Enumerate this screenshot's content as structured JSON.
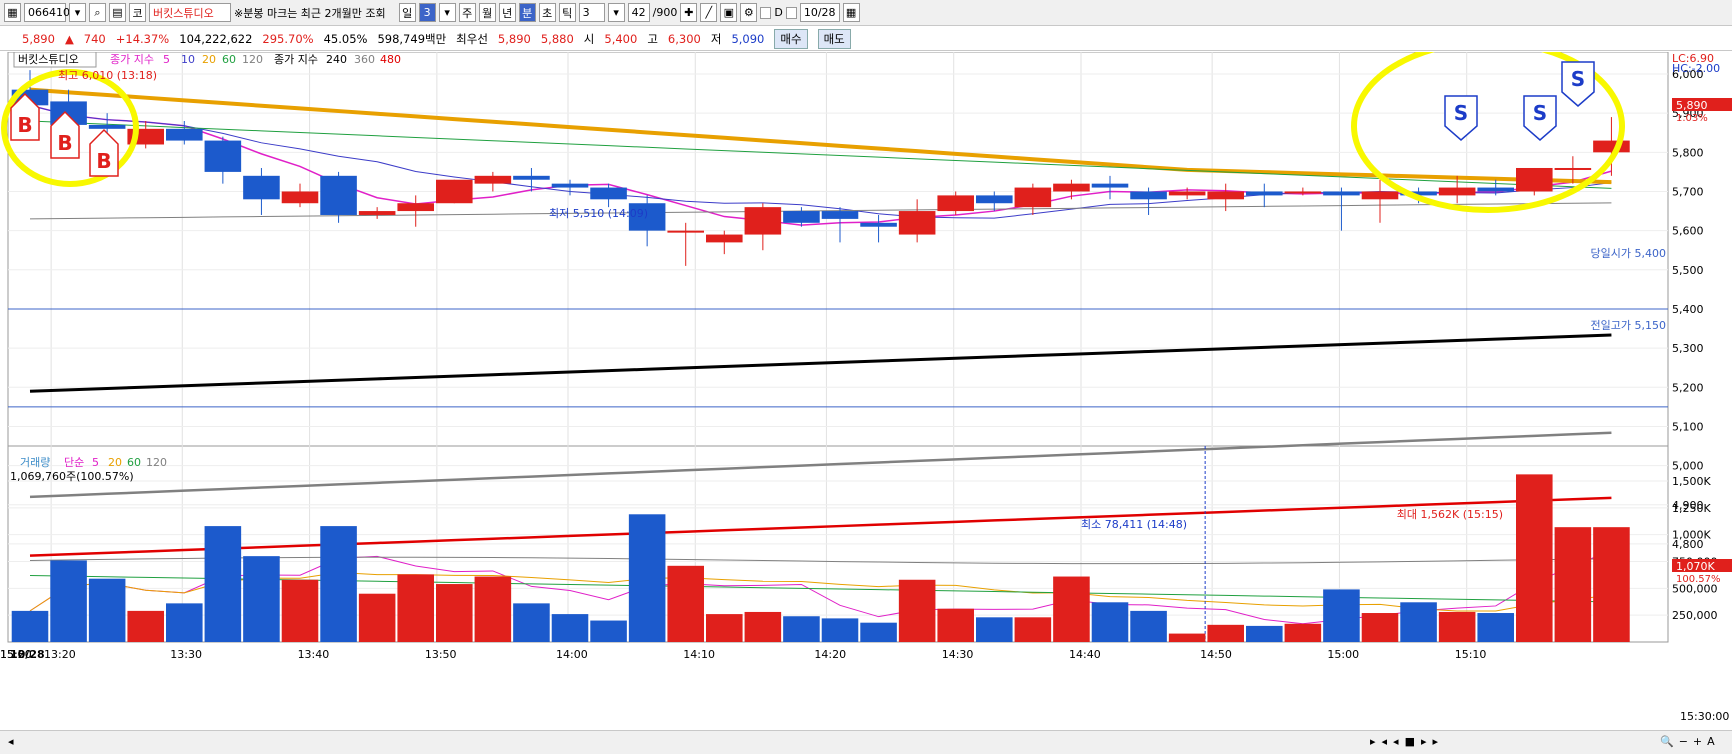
{
  "toolbar": {
    "code": "066410",
    "exchange_icon": "코",
    "stock_name": "버킷스튜디오",
    "notice": "※분봉 마크는 최근 2개월만 조회",
    "period_buttons": [
      "일",
      "3"
    ],
    "period_tabs": [
      "주",
      "월",
      "년",
      "분",
      "초",
      "틱"
    ],
    "interval": "3",
    "count": "42",
    "count_total": "/900",
    "d_label": "D",
    "date": "10/28"
  },
  "info": {
    "price": "5,890",
    "change": "740",
    "change_pct": "+14.37%",
    "volume": "104,222,622",
    "vol_ratio": "295.70%",
    "turnover": "45.05%",
    "amount": "598,749백만",
    "best_ask_label": "최우선",
    "best_ask": "5,890",
    "best_bid": "5,880",
    "open_label": "시",
    "open": "5,400",
    "high_label": "고",
    "high": "6,300",
    "low_label": "저",
    "low": "5,090",
    "buy_label": "매수",
    "sell_label": "매도"
  },
  "colors": {
    "up": "#e0201c",
    "down": "#1c5acc",
    "ma5": "#e020c8",
    "ma10": "#3c3cc8",
    "ma20": "#e8a000",
    "ma60": "#20a040",
    "ma120": "#808080",
    "ma240": "#000000",
    "ma360": "#808080",
    "ma480": "#e00000",
    "marker_yellow": "#f8f800"
  },
  "chart_data": [
    {
      "type": "candlestick",
      "legend": {
        "name": "버킷스튜디오",
        "close_ma_label": "종가 지수",
        "periods": [
          "5",
          "10",
          "20",
          "60",
          "120"
        ],
        "close_ma_label2": "종가 지수",
        "periods2": [
          "240",
          "360",
          "480"
        ]
      },
      "x": [
        "13:18",
        "13:21",
        "13:24",
        "13:27",
        "13:30",
        "13:33",
        "13:36",
        "13:39",
        "13:42",
        "13:45",
        "13:48",
        "13:51",
        "13:54",
        "13:57",
        "14:00",
        "14:03",
        "14:06",
        "14:09",
        "14:12",
        "14:15",
        "14:18",
        "14:21",
        "14:24",
        "14:27",
        "14:30",
        "14:33",
        "14:36",
        "14:39",
        "14:42",
        "14:45",
        "14:48",
        "14:51",
        "14:54",
        "14:57",
        "15:00",
        "15:03",
        "15:06",
        "15:09",
        "15:12",
        "15:15",
        "15:18",
        "15:30"
      ],
      "ohlc": [
        [
          5960,
          6010,
          5900,
          5920
        ],
        [
          5930,
          5960,
          5860,
          5870
        ],
        [
          5870,
          5900,
          5820,
          5860
        ],
        [
          5820,
          5880,
          5810,
          5860
        ],
        [
          5860,
          5880,
          5820,
          5830
        ],
        [
          5830,
          5840,
          5720,
          5750
        ],
        [
          5740,
          5760,
          5640,
          5680
        ],
        [
          5670,
          5720,
          5660,
          5700
        ],
        [
          5740,
          5750,
          5620,
          5640
        ],
        [
          5640,
          5660,
          5630,
          5650
        ],
        [
          5650,
          5690,
          5610,
          5670
        ],
        [
          5670,
          5730,
          5670,
          5730
        ],
        [
          5720,
          5750,
          5700,
          5740
        ],
        [
          5740,
          5760,
          5700,
          5730
        ],
        [
          5720,
          5730,
          5690,
          5710
        ],
        [
          5710,
          5720,
          5660,
          5680
        ],
        [
          5670,
          5690,
          5560,
          5600
        ],
        [
          5600,
          5620,
          5510,
          5600
        ],
        [
          5570,
          5600,
          5540,
          5590
        ],
        [
          5590,
          5670,
          5550,
          5660
        ],
        [
          5650,
          5660,
          5610,
          5620
        ],
        [
          5650,
          5660,
          5570,
          5630
        ],
        [
          5620,
          5640,
          5570,
          5610
        ],
        [
          5590,
          5680,
          5570,
          5650
        ],
        [
          5650,
          5700,
          5640,
          5690
        ],
        [
          5690,
          5700,
          5650,
          5670
        ],
        [
          5660,
          5720,
          5640,
          5710
        ],
        [
          5700,
          5730,
          5680,
          5720
        ],
        [
          5720,
          5740,
          5680,
          5710
        ],
        [
          5700,
          5710,
          5640,
          5680
        ],
        [
          5690,
          5710,
          5680,
          5700
        ],
        [
          5680,
          5720,
          5650,
          5700
        ],
        [
          5700,
          5720,
          5660,
          5690
        ],
        [
          5700,
          5710,
          5690,
          5700
        ],
        [
          5700,
          5710,
          5600,
          5690
        ],
        [
          5680,
          5730,
          5620,
          5700
        ],
        [
          5700,
          5710,
          5670,
          5690
        ],
        [
          5690,
          5740,
          5670,
          5710
        ],
        [
          5710,
          5730,
          5690,
          5700
        ],
        [
          5700,
          5760,
          5690,
          5760
        ],
        [
          5760,
          5790,
          5720,
          5760
        ],
        [
          5800,
          5890,
          5740,
          5830
        ]
      ],
      "y_ticks": [
        "6,000",
        "5,900",
        "5,800",
        "5,700",
        "5,600",
        "5,500",
        "5,400",
        "5,300",
        "5,200",
        "5,100",
        "5,000",
        "4,900",
        "4,800"
      ],
      "x_ticks": [
        "10/28",
        "13:20",
        "13:30",
        "13:40",
        "13:50",
        "14:00",
        "14:10",
        "14:20",
        "14:30",
        "14:40",
        "14:50",
        "15:00",
        "15:10",
        "15:20",
        "15:30"
      ],
      "annotations": {
        "high": "최고 6,010 (13:18)",
        "low": "최저 5,510 (14:09)",
        "open": "당일시가 5,400",
        "prev_high": "전일고가 5,150",
        "lc": "LC:6.90",
        "hc": "HC:-2.00",
        "last_price": "5,890",
        "last_pct": "1.03%"
      },
      "buy_markers": [
        "B",
        "B",
        "B"
      ],
      "sell_markers": [
        "S",
        "S",
        "S"
      ]
    },
    {
      "type": "bar",
      "legend": {
        "name": "거래량",
        "label": "단순",
        "periods": [
          "5",
          "20",
          "60",
          "120"
        ]
      },
      "current": "1,069,760주(100.57%)",
      "values": [
        290000,
        760000,
        590000,
        290000,
        360000,
        1080000,
        800000,
        580000,
        1080000,
        450000,
        630000,
        540000,
        610000,
        360000,
        260000,
        200000,
        1190000,
        710000,
        260000,
        280000,
        240000,
        220000,
        180000,
        580000,
        310000,
        230000,
        230000,
        610000,
        370000,
        290000,
        78411,
        160000,
        150000,
        170000,
        490000,
        270000,
        370000,
        280000,
        270000,
        1562000,
        1070000,
        1070000
      ],
      "y_ticks": [
        "1,500K",
        "1,250K",
        "1,000K",
        "750,000",
        "500,000",
        "250,000"
      ],
      "annotations": {
        "min": "최소 78,411 (14:48)",
        "max": "최대 1,562K (15:15)",
        "last": "1,070K",
        "last_pct": "100.57%",
        "x_end": "15:30:00"
      }
    }
  ]
}
